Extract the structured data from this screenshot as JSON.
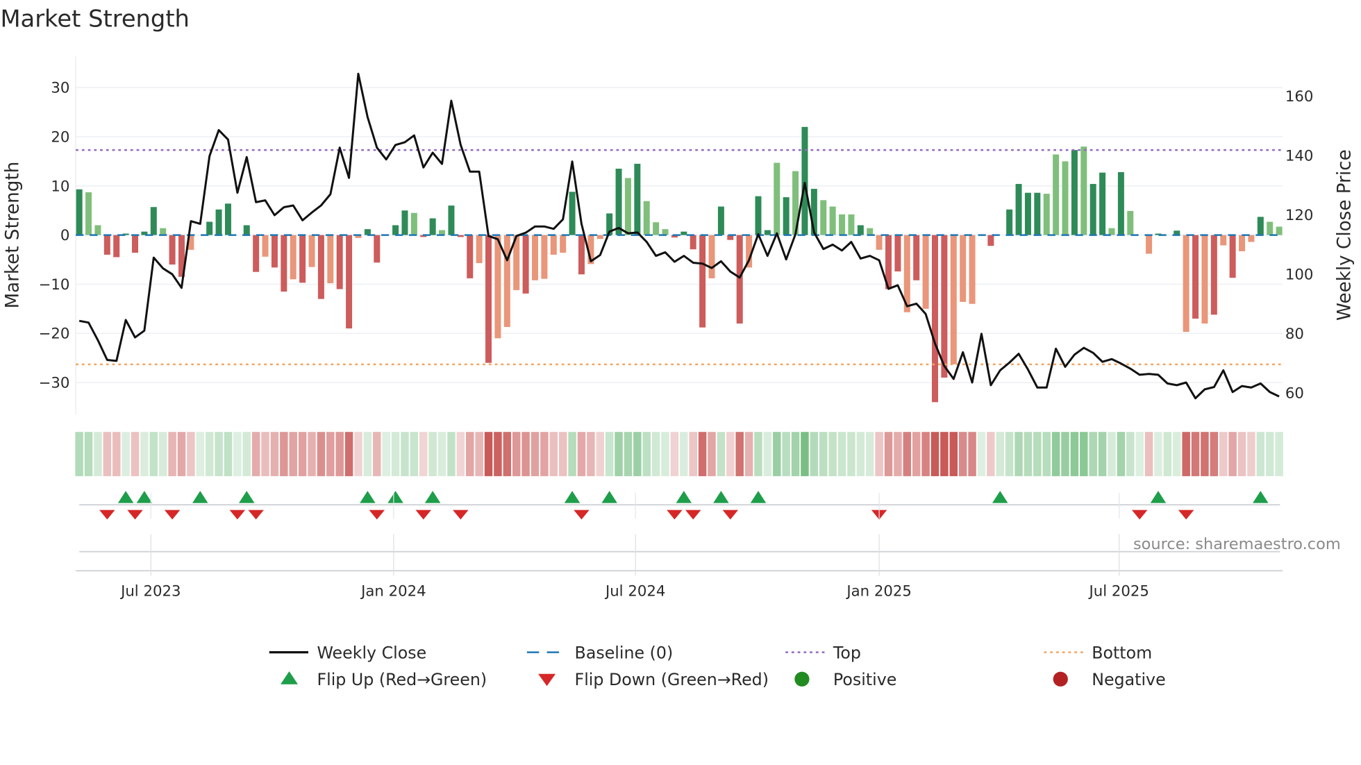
{
  "chart_data": {
    "type": "bar",
    "title": "Market Strength",
    "ylabel": "Market Strength",
    "y2label": "Weekly Close Price",
    "ylim": [
      -36,
      36
    ],
    "y2lim": [
      52.3,
      171.8
    ],
    "yticks": [
      30,
      20,
      10,
      0,
      -10,
      -20,
      -30
    ],
    "y2ticks": [
      160,
      140,
      120,
      100,
      80,
      60
    ],
    "x_interval": "weekly",
    "xticks": [
      {
        "label": "Jul 2023",
        "week": 7.7
      },
      {
        "label": "Jan 2024",
        "week": 33.8
      },
      {
        "label": "Jul 2024",
        "week": 59.8
      },
      {
        "label": "Jan 2025",
        "week": 86.0
      },
      {
        "label": "Jul 2025",
        "week": 111.8
      }
    ],
    "top_level": 17.3,
    "bottom_level": -26.3,
    "baseline": 0,
    "strength": [
      9.3,
      8.7,
      2,
      -4,
      -4.5,
      0.3,
      -3.6,
      0.7,
      5.7,
      1.4,
      -6,
      -8.5,
      -3,
      0,
      2.7,
      5.2,
      6.4,
      0,
      2,
      -7.5,
      -4.4,
      -6.6,
      -11.5,
      -9,
      -9.7,
      -6.5,
      -13,
      -9.8,
      -11,
      -19,
      -0.6,
      1.2,
      -5.6,
      0,
      2,
      5,
      4.5,
      -0.4,
      3.4,
      1,
      6,
      -0.4,
      -8.8,
      -5.7,
      -26,
      -21,
      -18.7,
      -11.2,
      -11.9,
      -9.2,
      -8.9,
      -4,
      -3.6,
      8.8,
      -8,
      -5.9,
      -0.8,
      4.4,
      13.5,
      11.6,
      14.5,
      6.9,
      2.6,
      1.2,
      -0.5,
      0.7,
      -2.9,
      -18.8,
      -8.8,
      5.8,
      -1,
      -18,
      -6.6,
      7.9,
      1,
      14.7,
      7.7,
      13,
      22,
      9.4,
      7.1,
      5.8,
      4.2,
      4.2,
      2,
      1.4,
      -3,
      -11,
      -7.4,
      -15.7,
      -9.2,
      -15,
      -34,
      -29,
      -26.3,
      -13.6,
      -14,
      0,
      -2.2,
      2,
      5.2,
      10.4,
      8.6,
      8.6,
      8.4,
      16.4,
      15,
      17.3,
      18,
      10.4,
      12.7,
      1.4,
      12.8,
      4.9,
      0,
      -3.8,
      0.3,
      3.3,
      0.9,
      -19.7,
      -17,
      -18,
      -16.2,
      -2.1,
      -8.7,
      -3.3,
      -1.4,
      3.7,
      2.7,
      1.7
    ],
    "shade": "SWWSSSSSSWSSWZSSSZSSWSSWSWSWSSWSSZSSWSSWSSSWSWWWSWWWWSSWWSSWSWWWSSSSWSSSWSSWSWSSWWWWSWWSSWSWSSWWWSSZSSSSWWWSWSSWSWSWSZSWSWSWSWWSWWSWW",
    "weekly_close": [
      84.3,
      83.7,
      77.8,
      71.1,
      70.8,
      84.6,
      78.7,
      81,
      105.6,
      102,
      100,
      95.4,
      117.9,
      117,
      139.8,
      148.6,
      145.4,
      127.5,
      139.5,
      124.3,
      124.9,
      119.9,
      122.6,
      123.2,
      118.2,
      120.8,
      123.2,
      127,
      142.7,
      132.5,
      167.6,
      153,
      142.7,
      138.7,
      143.6,
      144.5,
      146.8,
      136,
      141,
      137.2,
      158.5,
      143.6,
      134.6,
      134.6,
      112.9,
      111.8,
      104.7,
      112.9,
      114,
      116.1,
      116.1,
      115.3,
      118.5,
      138,
      117,
      104.4,
      106.5,
      114.4,
      115.6,
      113.8,
      114.1,
      110.9,
      106.2,
      107.4,
      104.2,
      106.2,
      103.9,
      103.6,
      102.1,
      104.4,
      100.9,
      98.9,
      104.7,
      113.5,
      106.2,
      113.8,
      105,
      113.5,
      130.8,
      114.1,
      108.5,
      110,
      108,
      110.9,
      105.3,
      106.2,
      104.7,
      95.1,
      96.3,
      89.2,
      90.1,
      86.6,
      76.7,
      69.1,
      64.7,
      73.7,
      63.5,
      79.9,
      62.6,
      67.6,
      70.2,
      73.2,
      67.9,
      61.8,
      61.8,
      74.9,
      68.8,
      72.9,
      75.2,
      73.5,
      70.5,
      71.4,
      69.9,
      68.2,
      66.1,
      66.4,
      66.1,
      63.2,
      62.6,
      63.5,
      58.2,
      61.2,
      62,
      67.6,
      60.3,
      62.3,
      61.8,
      63.2,
      60.3,
      58.8
    ],
    "flip_up_weeks": [
      5,
      7,
      13,
      18,
      31,
      34,
      38,
      53,
      57,
      65,
      69,
      73,
      99,
      116,
      127
    ],
    "flip_down_weeks": [
      3,
      6,
      10,
      17,
      19,
      32,
      37,
      41,
      54,
      64,
      66,
      70,
      86,
      114,
      119
    ],
    "colors": {
      "strong_green": "#2e8b57",
      "weak_green": "#7fbf7b",
      "strong_red": "#cd5c5c",
      "weak_red": "#e9967a",
      "close": "#111111",
      "baseline": "#1f77b4",
      "top": "#9467bd",
      "bottom": "#f4a460",
      "flip_up": "#1e9e4a",
      "flip_down": "#d62728",
      "positive": "#228b22",
      "negative": "#b22222"
    },
    "legend": {
      "placement": "bottom",
      "items": [
        {
          "label": "Weekly Close",
          "symbol": "line"
        },
        {
          "label": "Baseline (0)",
          "symbol": "dash"
        },
        {
          "label": "Top",
          "symbol": "dot-purple"
        },
        {
          "label": "Bottom",
          "symbol": "dot-orange"
        },
        {
          "label": "Flip Up (Red→Green)",
          "symbol": "triangle-up"
        },
        {
          "label": "Flip Down (Green→Red)",
          "symbol": "triangle-down"
        },
        {
          "label": "Positive",
          "symbol": "circle-green"
        },
        {
          "label": "Negative",
          "symbol": "circle-red"
        }
      ]
    },
    "source": "source: sharemaestro.com"
  }
}
